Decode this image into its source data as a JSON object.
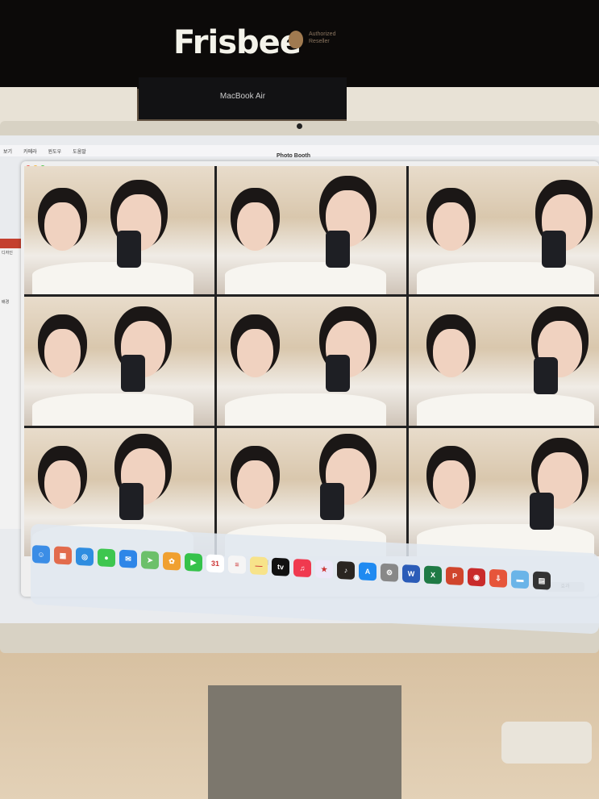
{
  "store_sign": {
    "title": "Frisbee",
    "subtitle": "Authorized Reseller",
    "display_text": "MacBook Air"
  },
  "menubar": {
    "items": [
      "보기",
      "카메라",
      "윈도우",
      "도움말"
    ]
  },
  "window": {
    "title": "Photo Booth"
  },
  "side_window": {
    "label": "디자인",
    "label2": "배경"
  },
  "pager": {
    "prev": "◀",
    "dots": "• • •",
    "next": "▶"
  },
  "effects_button": "효과",
  "dock": {
    "items": [
      {
        "name": "finder",
        "glyph": "☺",
        "color": "#3b8de6"
      },
      {
        "name": "launchpad",
        "glyph": "▦",
        "color": "#e26b4c"
      },
      {
        "name": "safari",
        "glyph": "◎",
        "color": "#2f8de0"
      },
      {
        "name": "messages",
        "glyph": "●",
        "color": "#3ec64f"
      },
      {
        "name": "mail",
        "glyph": "✉",
        "color": "#2e86e8"
      },
      {
        "name": "maps",
        "glyph": "➤",
        "color": "#6cc06a"
      },
      {
        "name": "photos",
        "glyph": "✿",
        "color": "#f0a030"
      },
      {
        "name": "facetime",
        "glyph": "▶",
        "color": "#35c24a"
      },
      {
        "name": "calendar",
        "glyph": "31",
        "color": "#ffffff"
      },
      {
        "name": "reminders",
        "glyph": "≡",
        "color": "#f5f5f5"
      },
      {
        "name": "notes",
        "glyph": "—",
        "color": "#f7e38a"
      },
      {
        "name": "apple-tv",
        "glyph": "tv",
        "color": "#111111"
      },
      {
        "name": "music",
        "glyph": "♫",
        "color": "#f0394f"
      },
      {
        "name": "imovie",
        "glyph": "★",
        "color": "#ece8f8"
      },
      {
        "name": "garageband",
        "glyph": "♪",
        "color": "#2a2521"
      },
      {
        "name": "app-store",
        "glyph": "A",
        "color": "#1f8af1"
      },
      {
        "name": "system-settings",
        "glyph": "⚙",
        "color": "#888888"
      },
      {
        "name": "word",
        "glyph": "W",
        "color": "#2b5cb8"
      },
      {
        "name": "excel",
        "glyph": "X",
        "color": "#1f7a45"
      },
      {
        "name": "powerpoint",
        "glyph": "P",
        "color": "#d0452c"
      },
      {
        "name": "photo-booth",
        "glyph": "◉",
        "color": "#c92b2b"
      },
      {
        "name": "downloads-app",
        "glyph": "⇩",
        "color": "#e6553a"
      },
      {
        "name": "folder",
        "glyph": "▬",
        "color": "#6ab4e8"
      },
      {
        "name": "screenshot",
        "glyph": "▤",
        "color": "#333333"
      }
    ]
  }
}
